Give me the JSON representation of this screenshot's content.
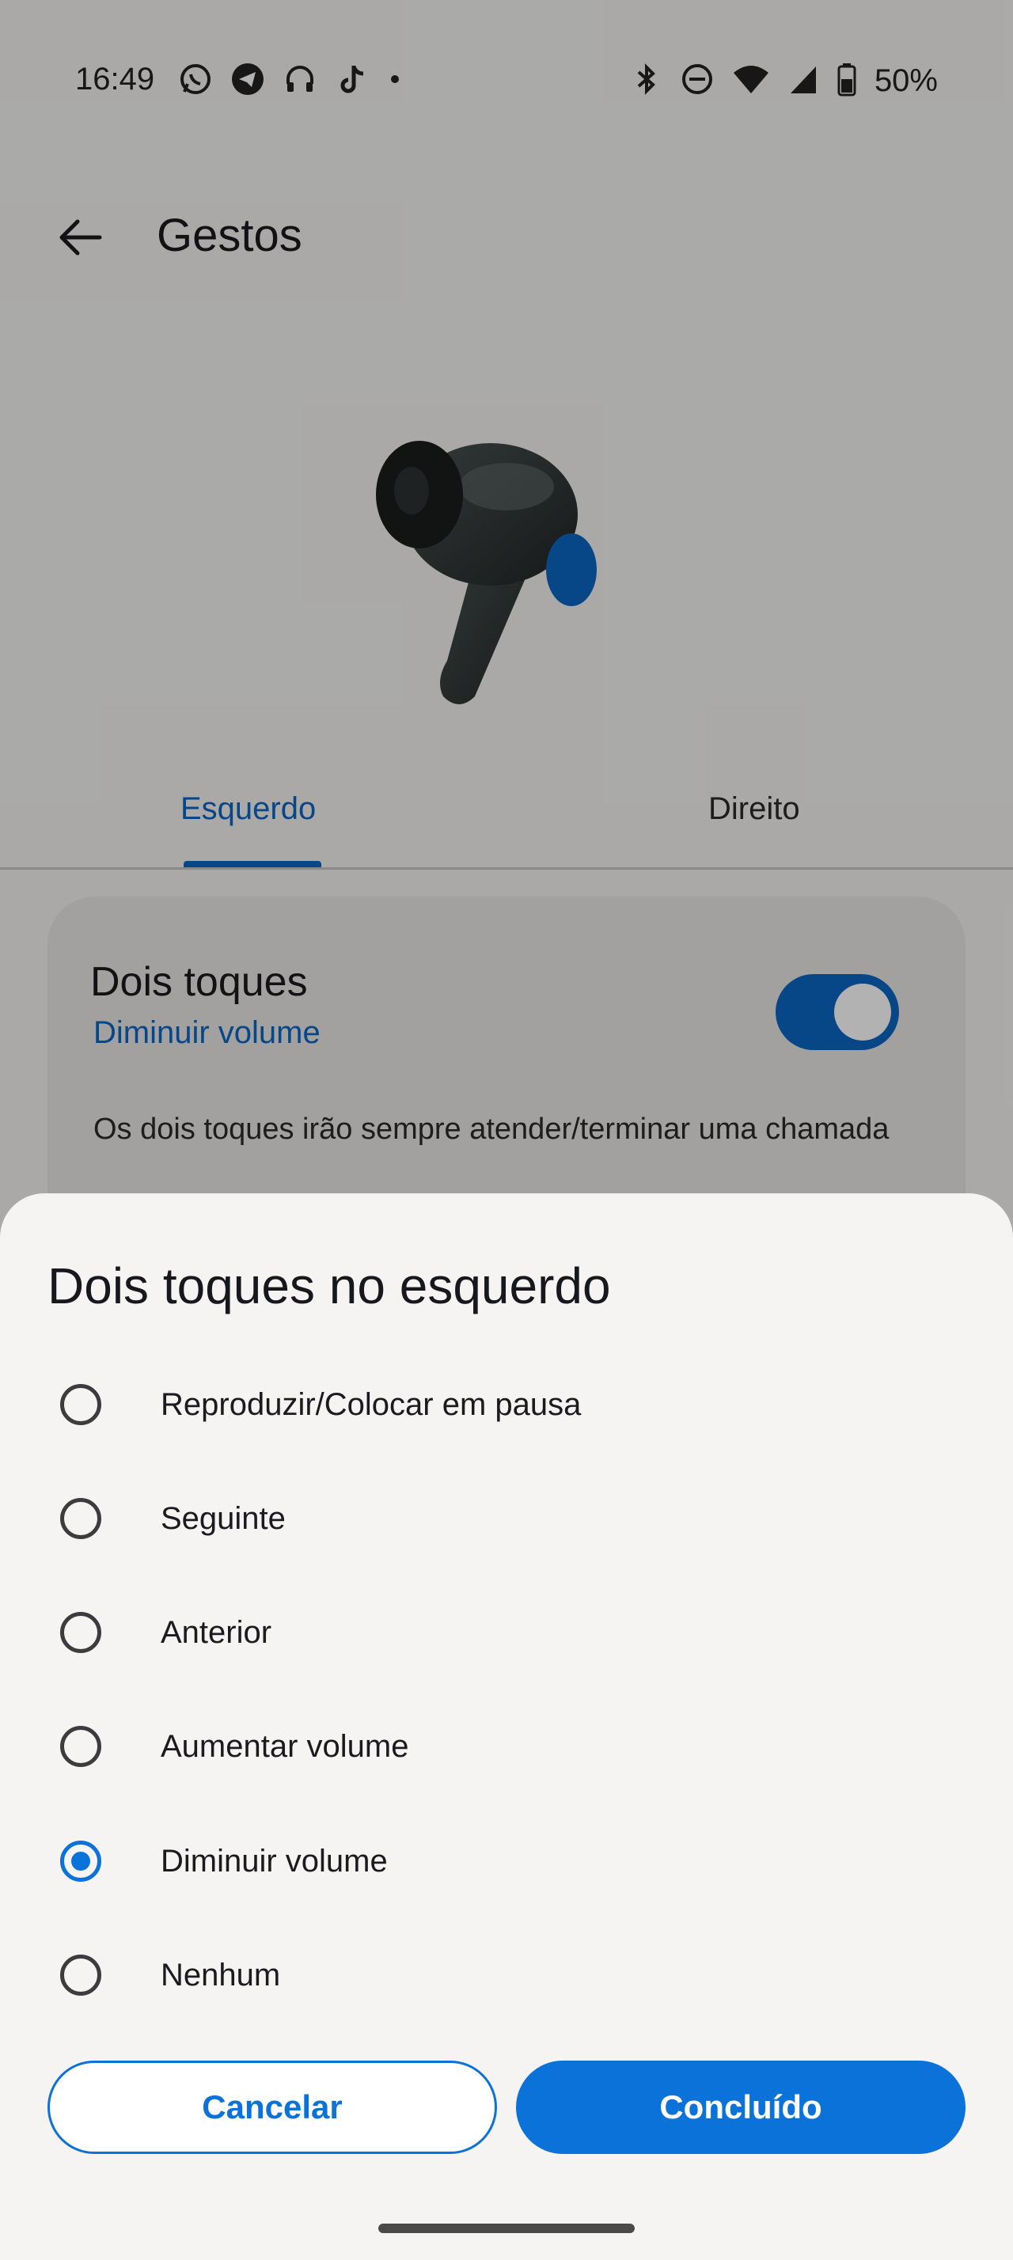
{
  "status_bar": {
    "time": "16:49",
    "left_icons": [
      "whatsapp-icon",
      "telegram-icon",
      "headphones-icon",
      "tiktok-icon",
      "dot-icon"
    ],
    "right_icons": [
      "bluetooth-icon",
      "do-not-disturb-icon",
      "wifi-icon",
      "signal-icon",
      "battery-icon"
    ],
    "battery": "50%"
  },
  "header": {
    "title": "Gestos"
  },
  "tabs": [
    {
      "label": "Esquerdo",
      "selected": true
    },
    {
      "label": "Direito",
      "selected": false
    }
  ],
  "card": {
    "title": "Dois toques",
    "subtitle": "Diminuir volume",
    "toggle_on": true,
    "note": "Os dois toques irão sempre atender/terminar uma chamada"
  },
  "sheet": {
    "title": "Dois toques no esquerdo",
    "options": [
      {
        "label": "Reproduzir/Colocar em pausa",
        "checked": false
      },
      {
        "label": "Seguinte",
        "checked": false
      },
      {
        "label": "Anterior",
        "checked": false
      },
      {
        "label": "Aumentar volume",
        "checked": false
      },
      {
        "label": "Diminuir volume",
        "checked": true
      },
      {
        "label": "Nenhum",
        "checked": false
      }
    ],
    "cancel_label": "Cancelar",
    "done_label": "Concluído"
  },
  "colors": {
    "accent": "#0b72d9",
    "tab_accent": "#0b66c3",
    "sheet_bg": "#f5f4f2"
  }
}
